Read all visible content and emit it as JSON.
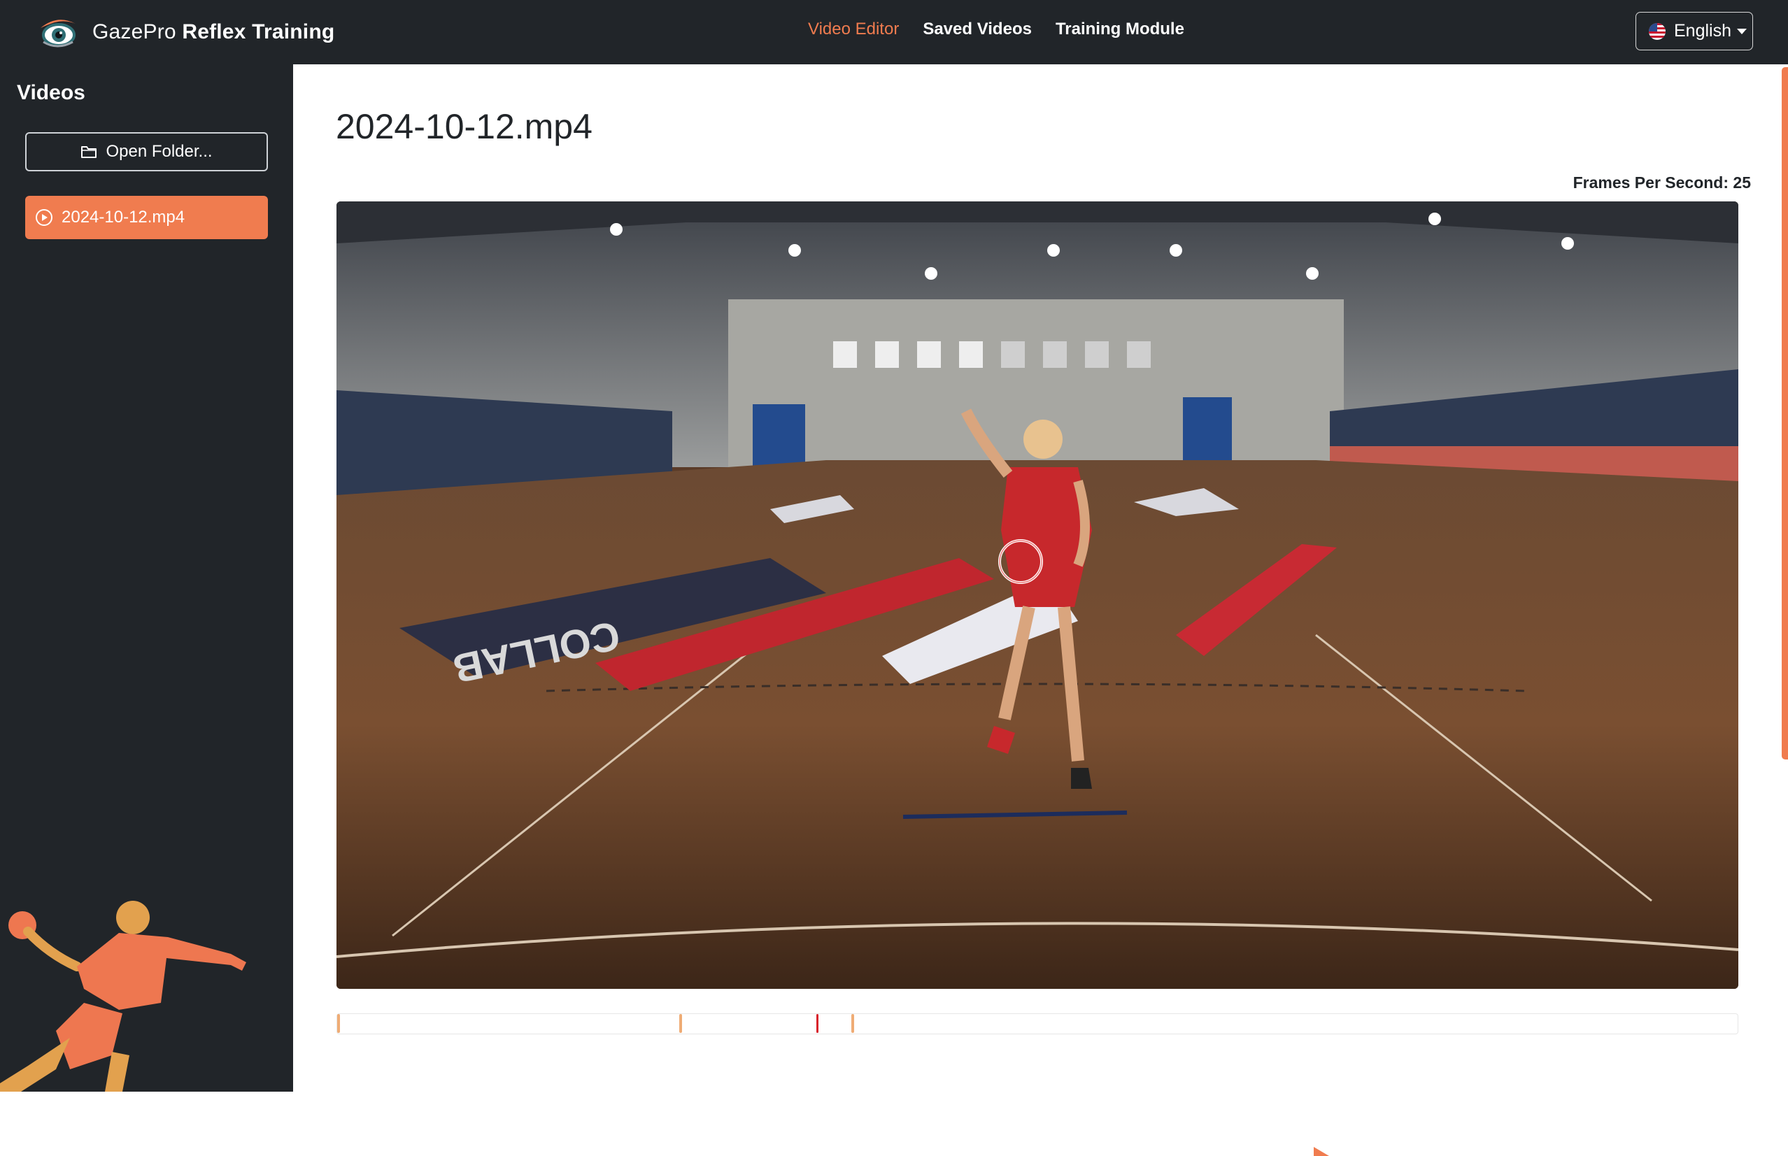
{
  "app": {
    "brand_light": "GazePro ",
    "brand_bold": "Reflex Training",
    "logo_icon": "eye-logo-icon"
  },
  "nav": {
    "items": [
      {
        "label": "Video Editor",
        "active": true
      },
      {
        "label": "Saved Videos",
        "active": false
      },
      {
        "label": "Training Module",
        "active": false
      }
    ],
    "language": "English",
    "language_icon": "us-flag-icon"
  },
  "sidebar": {
    "title": "Videos",
    "open_folder_label": "Open Folder...",
    "videos": [
      {
        "name": "2024-10-12.mp4",
        "selected": true
      }
    ]
  },
  "editor": {
    "title": "2024-10-12.mp4",
    "fps_label": "Frames Per Second: 25",
    "timeline_markers": [
      {
        "type": "orange",
        "position": 0.0
      },
      {
        "type": "orange",
        "position": 0.245
      },
      {
        "type": "red",
        "position": 0.342
      },
      {
        "type": "orange",
        "position": 0.368
      }
    ]
  },
  "colors": {
    "accent": "#f07c4f",
    "dark": "#212529",
    "marker_orange": "#efac75",
    "marker_red": "#d81f2a"
  }
}
